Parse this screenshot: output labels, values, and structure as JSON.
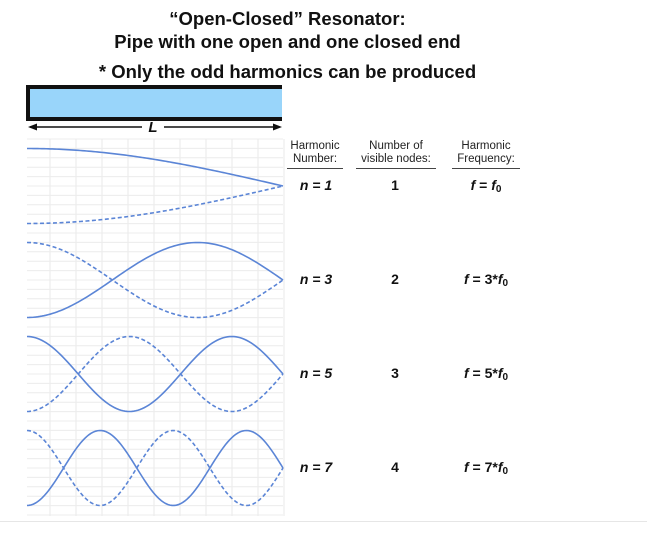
{
  "title": {
    "line1": "“Open-Closed” Resonator:",
    "line2": "Pipe with one open and one closed end",
    "note": "* Only the odd harmonics can be produced"
  },
  "pipe": {
    "closed_end": "left",
    "open_end": "right",
    "fill_color": "#99d5fa",
    "length_label": "L"
  },
  "columns": {
    "harmonic_number": "Harmonic Number:",
    "harmonic_number_l1": "Harmonic",
    "harmonic_number_l2": "Number:",
    "nodes_l1": "Number of",
    "nodes_l2": "visible nodes:",
    "freq_l1": "Harmonic",
    "freq_l2": "Frequency:"
  },
  "wave_color": "#5b85d6",
  "rows": [
    {
      "n": 1,
      "n_label": "n = 1",
      "nodes": "1",
      "freq_prefix": "f = ",
      "freq_coef": "",
      "freq_base": "f",
      "freq_sub": "0"
    },
    {
      "n": 3,
      "n_label": "n = 3",
      "nodes": "2",
      "freq_prefix": "f = ",
      "freq_coef": "3*",
      "freq_base": "f",
      "freq_sub": "0"
    },
    {
      "n": 5,
      "n_label": "n = 5",
      "nodes": "3",
      "freq_prefix": "f = ",
      "freq_coef": "5*",
      "freq_base": "f",
      "freq_sub": "0"
    },
    {
      "n": 7,
      "n_label": "n = 7",
      "nodes": "4",
      "freq_prefix": "f = ",
      "freq_coef": "7*",
      "freq_base": "f",
      "freq_sub": "0"
    }
  ]
}
